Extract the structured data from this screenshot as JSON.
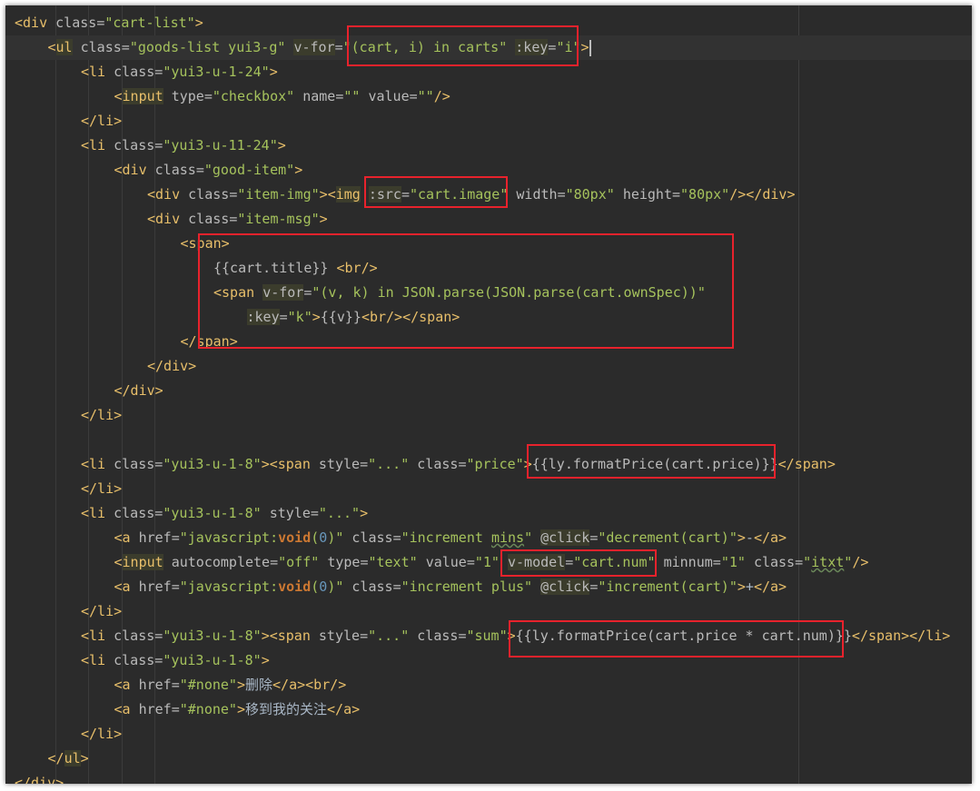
{
  "editor": {
    "lines": [
      [
        "<div class=\"cart-list\">"
      ],
      [
        "<ul class=\"goods-list yui3-g\" v-for=\"(cart, i) in carts\" :key=\"i\">"
      ],
      [
        "<li class=\"yui3-u-1-24\">"
      ],
      [
        "<input type=\"checkbox\" name=\"\" value=\"\"/>"
      ],
      [
        "</li>"
      ],
      [
        "<li class=\"yui3-u-11-24\">"
      ],
      [
        "<div class=\"good-item\">"
      ],
      [
        "<div class=\"item-img\"><img :src=\"cart.image\" width=\"80px\" height=\"80px\"/></div>"
      ],
      [
        "<div class=\"item-msg\">"
      ],
      [
        "<span>"
      ],
      [
        "{{cart.title}} <br/>"
      ],
      [
        "<span v-for=\"(v, k) in JSON.parse(JSON.parse(cart.ownSpec))\""
      ],
      [
        ":key=\"k\">{{v}}<br/></span>"
      ],
      [
        "</span>"
      ],
      [
        "</div>"
      ],
      [
        "</div>"
      ],
      [
        "</li>"
      ],
      [
        ""
      ],
      [
        "<li class=\"yui3-u-1-8\"><span style=\"...\" class=\"price\">{{ly.formatPrice(cart.price)}}</span>"
      ],
      [
        "</li>"
      ],
      [
        "<li class=\"yui3-u-1-8\" style=\"...\">"
      ],
      [
        "<a href=\"javascript:void(0)\" class=\"increment mins\" @click=\"decrement(cart)\">-</a>"
      ],
      [
        "<input autocomplete=\"off\" type=\"text\" value=\"1\" v-model=\"cart.num\" minnum=\"1\" class=\"itxt\"/>"
      ],
      [
        "<a href=\"javascript:void(0)\" class=\"increment plus\" @click=\"increment(cart)\">+</a>"
      ],
      [
        "</li>"
      ],
      [
        "<li class=\"yui3-u-1-8\"><span style=\"...\" class=\"sum\">{{ly.formatPrice(cart.price * cart.num)}}</span></li>"
      ],
      [
        "<li class=\"yui3-u-1-8\">"
      ],
      [
        "<a href=\"#none\">删除</a><br/>"
      ],
      [
        "<a href=\"#none\">移到我的关注</a>"
      ],
      [
        "</li>"
      ],
      [
        "</ul>"
      ],
      [
        "</div>"
      ]
    ]
  }
}
